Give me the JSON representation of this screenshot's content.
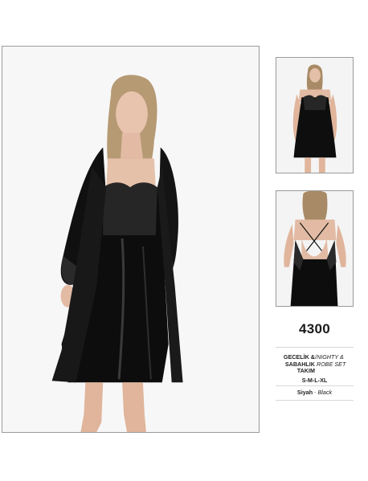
{
  "product": {
    "code": "4300",
    "name_tr": "GECELİK & SABAHLIK TAKIM",
    "name_separator": "/",
    "name_en": "NIGHTY & ROBE SET",
    "sizes": "S-M-L-XL",
    "color_tr": "Siyah",
    "color_separator": "-",
    "color_en": "Black"
  },
  "images": {
    "main": "model-wearing-black-satin-nightgown-and-robe",
    "front": "model-front-view-black-satin-nightgown",
    "back": "model-back-view-black-satin-nightgown"
  },
  "colors": {
    "garment": "#0d0d0d",
    "frame_border": "#9a9a9a",
    "text": "#1a1a1a",
    "divider": "#d8d8d8"
  }
}
